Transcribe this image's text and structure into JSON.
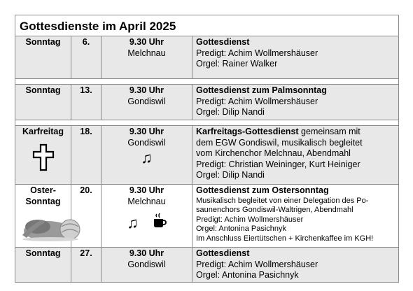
{
  "title": "Gottesdienste im April 2025",
  "rows": [
    {
      "day": "Sonntag",
      "date": "6.",
      "time": "9.30 Uhr",
      "place": "Melchnau",
      "heading": "Gottesdienst",
      "heading_rest": "",
      "lines": [
        "Predigt: Achim Wollmershäuser",
        "Orgel: Rainer Walker"
      ]
    },
    {
      "day": "Sonntag",
      "date": "13.",
      "time": "9.30 Uhr",
      "place": "Gondiswil",
      "heading": "Gottesdienst zum Palmsonntag",
      "heading_rest": "",
      "lines": [
        "Predigt: Achim Wollmershäuser",
        "Orgel: Dilip Nandi"
      ]
    },
    {
      "day": "Karfreitag",
      "date": "18.",
      "time": "9.30 Uhr",
      "place": "Gondiswil",
      "heading": "Karfreitags-Gottesdienst",
      "heading_rest": " gemeinsam mit",
      "lines": [
        "dem EGW Gondiswil, musikalisch begleitet",
        "vom Kirchenchor Melchnau, Abendmahl",
        "Predigt: Christian Weininger, Kurt Heiniger",
        "Orgel: Dilip Nandi"
      ],
      "icons": [
        "cross-icon",
        "music-note-icon"
      ]
    },
    {
      "day_line1": "Oster-",
      "day_line2": "Sonntag",
      "date": "20.",
      "time": "9.30 Uhr",
      "place": "Melchnau",
      "heading": "Gottesdienst zum Ostersonntag",
      "heading_rest": "",
      "small_lines": [
        "Musikalisch begleitet von einer Delegation des Po-",
        "saunenchors Gondiswil-Waltrigen, Abendmahl",
        "Predigt: Achim Wollmershäuser",
        "Orgel: Antonina Pasichnyk",
        "Im Anschluss Eiertütschen + Kirchenkaffee im KGH!"
      ],
      "icons": [
        "easter-bunny-image",
        "music-note-icon",
        "coffee-cup-icon"
      ]
    },
    {
      "day": "Sonntag",
      "date": "27.",
      "time": "9.30 Uhr",
      "place": "Gondiswil",
      "heading": "Gottesdienst",
      "heading_rest": "",
      "lines": [
        "Predigt: Achim Wollmershäuser",
        "Orgel: Antonina Pasichnyk"
      ]
    }
  ]
}
